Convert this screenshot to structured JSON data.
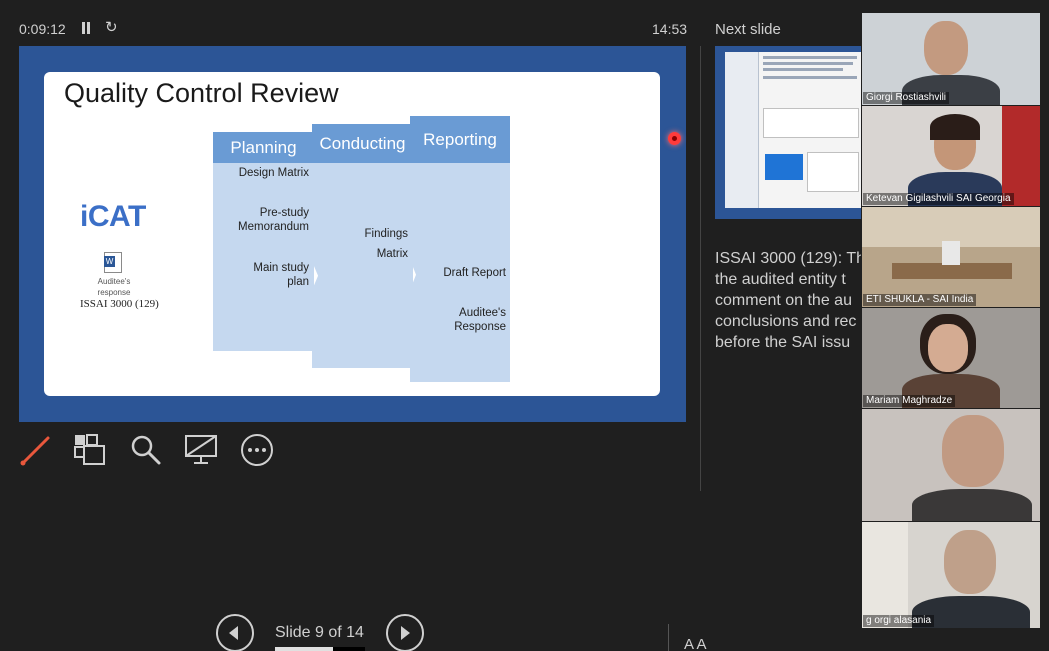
{
  "presenter": {
    "elapsed_time": "0:09:12",
    "clock": "14:53",
    "next_slide_label": "Next slide",
    "slide_counter": "Slide 9 of 14",
    "progress": 0.64,
    "font_size_controls": "A  A"
  },
  "slide": {
    "title": "Quality Control Review",
    "logo_text": "iCAT",
    "doc_label": "Auditee's response",
    "issai_text": "ISSAI 3000 (129)",
    "columns": [
      {
        "header": "Planning",
        "items": [
          "Design Matrix",
          "Pre-study Memorandum",
          "Main study plan"
        ]
      },
      {
        "header": "Conducting",
        "items": [
          "Findings",
          "Matrix"
        ]
      },
      {
        "header": "Reporting",
        "items": [
          "Draft Report",
          "Auditee's Response"
        ]
      }
    ]
  },
  "notes": {
    "lines": [
      "ISSAI 3000 (129): Th",
      "the audited entity t",
      "comment on the au",
      "conclusions and rec",
      "before the SAI issu"
    ]
  },
  "participants": [
    {
      "name": "Giorgi Rostiashvili"
    },
    {
      "name": "Ketevan Gigilashvili SAI Georgia"
    },
    {
      "name": "ETI SHUKLA - SAI India"
    },
    {
      "name": "Mariam Maghradze"
    },
    {
      "name": ""
    },
    {
      "name": "g orgi alasania"
    }
  ],
  "colors": {
    "background": "#1f1f1f",
    "slide_frame": "#2c5596",
    "column_header": "#6a9bd4",
    "column_body": "#c5d8ef",
    "laser": "#ff3b3b",
    "pen": "#e8573c"
  },
  "icons": [
    "pause-icon",
    "reset-icon",
    "pen-icon",
    "grid-icon",
    "zoom-icon",
    "screen-icon",
    "more-icon",
    "prev-icon",
    "next-icon",
    "laser-pointer-icon"
  ]
}
